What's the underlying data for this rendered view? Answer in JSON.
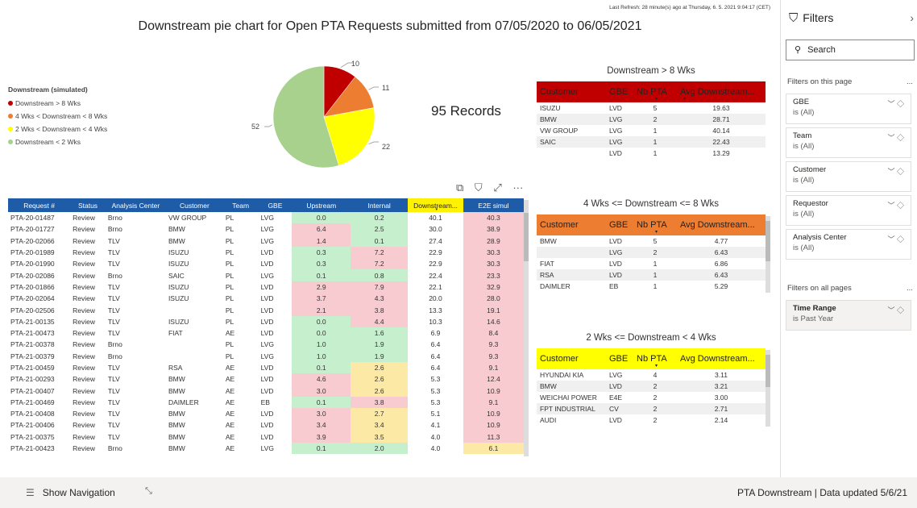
{
  "refresh": "Last Refresh: 28 minute(s) ago at Thursday, 6. 5. 2021 9:04:17 (CET)",
  "title": "Downstream pie chart for Open PTA Requests submitted from  07/05/2020  to  06/05/2021",
  "legend": {
    "title": "Downstream (simulated)",
    "items": [
      {
        "label": "Downstream > 8 Wks",
        "color": "#c00000"
      },
      {
        "label": "4 Wks < Downstream < 8 Wks",
        "color": "#ed7d31"
      },
      {
        "label": "2 Wks < Downstream < 4 Wks",
        "color": "#ffff00"
      },
      {
        "label": "Downstream < 2 Wks",
        "color": "#a9d18e"
      }
    ]
  },
  "chart_data": {
    "type": "pie",
    "title": "",
    "categories": [
      "Downstream > 8 Wks",
      "4 Wks < Downstream < 8 Wks",
      "2 Wks < Downstream < 4 Wks",
      "Downstream < 2 Wks"
    ],
    "values": [
      10,
      11,
      22,
      52
    ],
    "colors": [
      "#c00000",
      "#ed7d31",
      "#ffff00",
      "#a9d18e"
    ]
  },
  "records": "95 Records",
  "t8": {
    "title": "Downstream > 8 Wks",
    "headers": [
      "Customer",
      "GBE",
      "Nb PTA",
      "Avg Downstream..."
    ],
    "rows": [
      [
        "ISUZU",
        "LVD",
        "5",
        "19.63"
      ],
      [
        "BMW",
        "LVG",
        "2",
        "28.71"
      ],
      [
        "VW GROUP",
        "LVG",
        "1",
        "40.14"
      ],
      [
        "SAIC",
        "LVG",
        "1",
        "22.43"
      ],
      [
        "",
        "LVD",
        "1",
        "13.29"
      ]
    ]
  },
  "t48": {
    "title": "4 Wks <= Downstream <= 8 Wks",
    "headers": [
      "Customer",
      "GBE",
      "Nb PTA",
      "Avg Downstream..."
    ],
    "rows": [
      [
        "BMW",
        "LVD",
        "5",
        "4.77"
      ],
      [
        "",
        "LVG",
        "2",
        "6.43"
      ],
      [
        "FIAT",
        "LVD",
        "1",
        "6.86"
      ],
      [
        "RSA",
        "LVD",
        "1",
        "6.43"
      ],
      [
        "DAIMLER",
        "EB",
        "1",
        "5.29"
      ]
    ]
  },
  "t24": {
    "title": "2 Wks <= Downstream < 4 Wks",
    "headers": [
      "Customer",
      "GBE",
      "Nb PTA",
      "Avg Downstream..."
    ],
    "rows": [
      [
        "HYUNDAI KIA",
        "LVG",
        "4",
        "3.11"
      ],
      [
        "BMW",
        "LVD",
        "2",
        "3.21"
      ],
      [
        "WEICHAI POWER",
        "E4E",
        "2",
        "3.00"
      ],
      [
        "FPT INDUSTRIAL",
        "CV",
        "2",
        "2.71"
      ],
      [
        "AUDI",
        "LVD",
        "2",
        "2.14"
      ]
    ]
  },
  "toolbar": {
    "copy": "⧉",
    "filter": "⛉",
    "focus": "⤢",
    "more": "···"
  },
  "main_table": {
    "headers": [
      "Request #",
      "Status",
      "Analysis Center",
      "Customer",
      "Team",
      "GBE",
      "Upstream",
      "Internal",
      "Downstream...",
      "E2E simul"
    ],
    "rows": [
      {
        "cells": [
          "PTA-20-01487",
          "Review",
          "Brno",
          "VW GROUP",
          "PL",
          "LVG",
          "0.0",
          "0.2",
          "40.1",
          "40.3"
        ],
        "up": "g",
        "in": "g",
        "e2e": "r"
      },
      {
        "cells": [
          "PTA-20-01727",
          "Review",
          "Brno",
          "BMW",
          "PL",
          "LVG",
          "6.4",
          "2.5",
          "30.0",
          "38.9"
        ],
        "up": "r",
        "in": "g",
        "e2e": "r"
      },
      {
        "cells": [
          "PTA-20-02066",
          "Review",
          "TLV",
          "BMW",
          "PL",
          "LVG",
          "1.4",
          "0.1",
          "27.4",
          "28.9"
        ],
        "up": "r",
        "in": "g",
        "e2e": "r"
      },
      {
        "cells": [
          "PTA-20-01989",
          "Review",
          "TLV",
          "ISUZU",
          "PL",
          "LVD",
          "0.3",
          "7.2",
          "22.9",
          "30.3"
        ],
        "up": "g",
        "in": "r",
        "e2e": "r"
      },
      {
        "cells": [
          "PTA-20-01990",
          "Review",
          "TLV",
          "ISUZU",
          "PL",
          "LVD",
          "0.3",
          "7.2",
          "22.9",
          "30.3"
        ],
        "up": "g",
        "in": "r",
        "e2e": "r"
      },
      {
        "cells": [
          "PTA-20-02086",
          "Review",
          "Brno",
          "SAIC",
          "PL",
          "LVG",
          "0.1",
          "0.8",
          "22.4",
          "23.3"
        ],
        "up": "g",
        "in": "g",
        "e2e": "r"
      },
      {
        "cells": [
          "PTA-20-01866",
          "Review",
          "TLV",
          "ISUZU",
          "PL",
          "LVD",
          "2.9",
          "7.9",
          "22.1",
          "32.9"
        ],
        "up": "r",
        "in": "r",
        "e2e": "r"
      },
      {
        "cells": [
          "PTA-20-02064",
          "Review",
          "TLV",
          "ISUZU",
          "PL",
          "LVD",
          "3.7",
          "4.3",
          "20.0",
          "28.0"
        ],
        "up": "r",
        "in": "r",
        "e2e": "r"
      },
      {
        "cells": [
          "PTA-20-02506",
          "Review",
          "TLV",
          "",
          "PL",
          "LVD",
          "2.1",
          "3.8",
          "13.3",
          "19.1"
        ],
        "up": "r",
        "in": "r",
        "e2e": "r"
      },
      {
        "cells": [
          "PTA-21-00135",
          "Review",
          "TLV",
          "ISUZU",
          "PL",
          "LVD",
          "0.0",
          "4.4",
          "10.3",
          "14.6"
        ],
        "up": "g",
        "in": "r",
        "e2e": "r"
      },
      {
        "cells": [
          "PTA-21-00473",
          "Review",
          "TLV",
          "FIAT",
          "AE",
          "LVD",
          "0.0",
          "1.6",
          "6.9",
          "8.4"
        ],
        "up": "g",
        "in": "g",
        "e2e": "r"
      },
      {
        "cells": [
          "PTA-21-00378",
          "Review",
          "Brno",
          "",
          "PL",
          "LVG",
          "1.0",
          "1.9",
          "6.4",
          "9.3"
        ],
        "up": "g",
        "in": "g",
        "e2e": "r"
      },
      {
        "cells": [
          "PTA-21-00379",
          "Review",
          "Brno",
          "",
          "PL",
          "LVG",
          "1.0",
          "1.9",
          "6.4",
          "9.3"
        ],
        "up": "g",
        "in": "g",
        "e2e": "r"
      },
      {
        "cells": [
          "PTA-21-00459",
          "Review",
          "TLV",
          "RSA",
          "AE",
          "LVD",
          "0.1",
          "2.6",
          "6.4",
          "9.1"
        ],
        "up": "g",
        "in": "y",
        "e2e": "r"
      },
      {
        "cells": [
          "PTA-21-00293",
          "Review",
          "TLV",
          "BMW",
          "AE",
          "LVD",
          "4.6",
          "2.6",
          "5.3",
          "12.4"
        ],
        "up": "r",
        "in": "y",
        "e2e": "r"
      },
      {
        "cells": [
          "PTA-21-00407",
          "Review",
          "TLV",
          "BMW",
          "AE",
          "LVD",
          "3.0",
          "2.6",
          "5.3",
          "10.9"
        ],
        "up": "r",
        "in": "y",
        "e2e": "r"
      },
      {
        "cells": [
          "PTA-21-00469",
          "Review",
          "TLV",
          "DAIMLER",
          "AE",
          "EB",
          "0.1",
          "3.8",
          "5.3",
          "9.1"
        ],
        "up": "g",
        "in": "r",
        "e2e": "r"
      },
      {
        "cells": [
          "PTA-21-00408",
          "Review",
          "TLV",
          "BMW",
          "AE",
          "LVD",
          "3.0",
          "2.7",
          "5.1",
          "10.9"
        ],
        "up": "r",
        "in": "y",
        "e2e": "r"
      },
      {
        "cells": [
          "PTA-21-00406",
          "Review",
          "TLV",
          "BMW",
          "AE",
          "LVD",
          "3.4",
          "3.4",
          "4.1",
          "10.9"
        ],
        "up": "r",
        "in": "y",
        "e2e": "r"
      },
      {
        "cells": [
          "PTA-21-00375",
          "Review",
          "TLV",
          "BMW",
          "AE",
          "LVD",
          "3.9",
          "3.5",
          "4.0",
          "11.3"
        ],
        "up": "r",
        "in": "y",
        "e2e": "r"
      },
      {
        "cells": [
          "PTA-21-00423",
          "Review",
          "Brno",
          "BMW",
          "AE",
          "LVG",
          "0.1",
          "2.0",
          "4.0",
          "6.1"
        ],
        "up": "g",
        "in": "g",
        "e2e": "y"
      }
    ]
  },
  "filters": {
    "title": "Filters",
    "search_placeholder": "Search",
    "on_page_label": "Filters on this page",
    "all_pages_label": "Filters on all pages",
    "dots": "...",
    "page_filters": [
      {
        "name": "GBE",
        "value": "is (All)"
      },
      {
        "name": "Team",
        "value": "is (All)"
      },
      {
        "name": "Customer",
        "value": "is (All)"
      },
      {
        "name": "Requestor",
        "value": "is (All)"
      },
      {
        "name": "Analysis Center",
        "value": "is (All)"
      }
    ],
    "global_filter": {
      "name": "Time Range",
      "value": "is Past Year"
    }
  },
  "bottom": {
    "nav_label": "Show Navigation",
    "status": "PTA Downstream  |  Data updated 5/6/21"
  }
}
